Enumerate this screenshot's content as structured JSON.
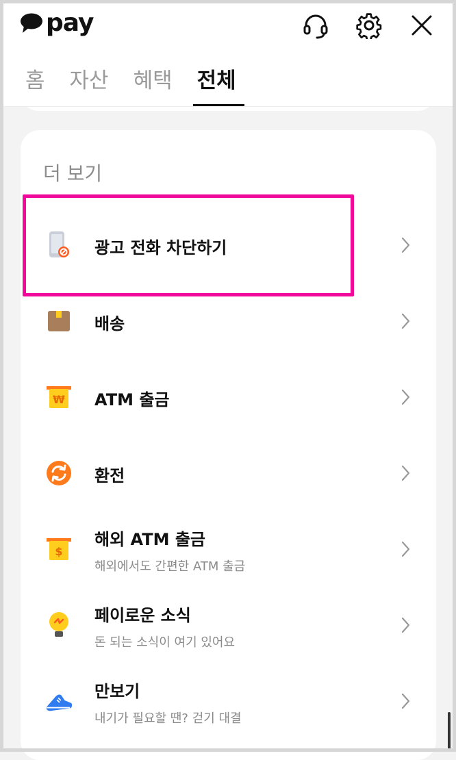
{
  "header": {
    "logo_text": "pay",
    "support_icon": "headset-icon",
    "settings_icon": "gear-icon",
    "close_icon": "close-icon"
  },
  "tabs": [
    {
      "label": "홈",
      "active": false
    },
    {
      "label": "자산",
      "active": false
    },
    {
      "label": "혜택",
      "active": false
    },
    {
      "label": "전체",
      "active": true
    }
  ],
  "section": {
    "title": "더 보기",
    "items": [
      {
        "title": "광고 전화 차단하기",
        "subtitle": "",
        "icon": "phone-block-icon"
      },
      {
        "title": "배송",
        "subtitle": "",
        "icon": "package-icon"
      },
      {
        "title": "ATM 출금",
        "subtitle": "",
        "icon": "atm-won-icon"
      },
      {
        "title": "환전",
        "subtitle": "",
        "icon": "exchange-icon"
      },
      {
        "title": "해외 ATM 출금",
        "subtitle": "해외에서도 간편한 ATM 출금",
        "icon": "atm-dollar-icon"
      },
      {
        "title": "페이로운 소식",
        "subtitle": "돈 되는 소식이 여기 있어요",
        "icon": "lightbulb-icon"
      },
      {
        "title": "만보기",
        "subtitle": "내기가 필요할 땐? 걷기 대결",
        "icon": "sneaker-icon"
      }
    ]
  },
  "colors": {
    "highlight": "#f0099a",
    "accent_yellow": "#ffcd1e",
    "accent_orange": "#ff7a1a"
  }
}
